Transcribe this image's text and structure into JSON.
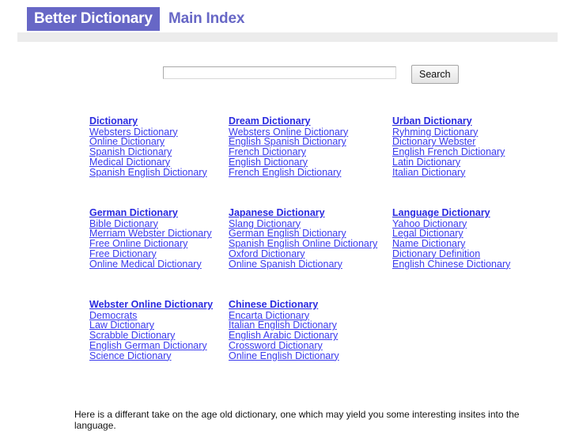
{
  "header": {
    "brand": "Better Dictionary",
    "page_title": "Main Index",
    "brand_bg_color": "#6767c6",
    "title_color": "#6767c6",
    "rule_color": "#ececec"
  },
  "search": {
    "value": "",
    "placeholder": "",
    "button_label": "Search"
  },
  "link_color": "#3a3aee",
  "heading_color": "#2a2ae0",
  "grid": {
    "rows": [
      {
        "columns": [
          {
            "heading": "Dictionary",
            "links": [
              "Websters Dictionary",
              "Online Dictionary",
              "Spanish Dictionary",
              "Medical Dictionary",
              "Spanish English Dictionary"
            ]
          },
          {
            "heading": "Dream Dictionary",
            "links": [
              "Websters Online Dictionary",
              "English Spanish Dictionary",
              "French Dictionary",
              "English Dictionary",
              "French English Dictionary"
            ]
          },
          {
            "heading": "Urban Dictionary",
            "links": [
              "Ryhming Dictionary",
              "Dictionary Webster",
              "English French Dictionary",
              "Latin Dictionary",
              "Italian Dictionary"
            ]
          }
        ]
      },
      {
        "columns": [
          {
            "heading": "German Dictionary",
            "links": [
              "Bible Dictionary",
              "Merriam Webster Dictionary",
              "Free Online Dictionary",
              "Free Dictionary",
              "Online Medical Dictionary"
            ]
          },
          {
            "heading": "Japanese Dictionary",
            "links": [
              "Slang Dictionary",
              "German English Dictionary",
              "Spanish English Online Dictionary",
              "Oxford Dictionary",
              "Online Spanish Dictionary"
            ]
          },
          {
            "heading": "Language Dictionary",
            "links": [
              "Yahoo Dictionary",
              "Legal Dictionary",
              "Name Dictionary",
              "Dictionary Definition",
              "English Chinese Dictionary"
            ]
          }
        ]
      },
      {
        "columns": [
          {
            "heading": "Webster Online Dictionary",
            "links": [
              "Democrats",
              "Law Dictionary",
              "Scrabble Dictionary",
              "English German Dictionary",
              "Science Dictionary"
            ]
          },
          {
            "heading": "Chinese Dictionary",
            "links": [
              "Encarta Dictionary",
              "Italian English Dictionary",
              "English Arabic Dictionary",
              "Crossword Dictionary",
              "Online English Dictionary"
            ]
          }
        ]
      }
    ]
  },
  "footer": {
    "note": "Here is a differant take on the age old dictionary, one which may yield you some interesting insites into the language."
  }
}
